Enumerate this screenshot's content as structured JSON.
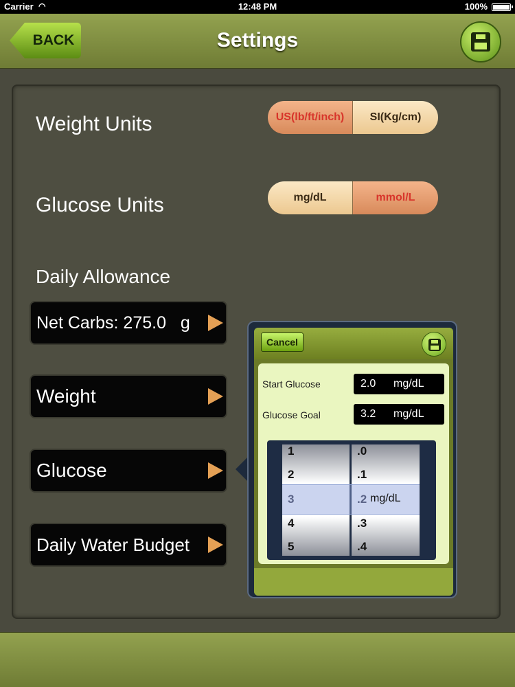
{
  "status_bar": {
    "carrier": "Carrier",
    "time": "12:48 PM",
    "battery": "100%"
  },
  "nav": {
    "back_label": "BACK",
    "title": "Settings",
    "save_icon": "floppy-disk-icon"
  },
  "settings": {
    "weight_units": {
      "label": "Weight Units",
      "options": [
        "US(lb/ft/inch)",
        "SI(Kg/cm)"
      ],
      "selected": "US(lb/ft/inch)"
    },
    "glucose_units": {
      "label": "Glucose Units",
      "options": [
        "mg/dL",
        "mmol/L"
      ],
      "selected": "mmol/L"
    },
    "daily_allowance_label": "Daily Allowance",
    "menu": [
      {
        "label": "Net Carbs: 275.0   g"
      },
      {
        "label": "Weight"
      },
      {
        "label": "Glucose"
      },
      {
        "label": "Daily Water Budget"
      }
    ]
  },
  "popover": {
    "cancel_label": "Cancel",
    "start_glucose": {
      "label": "Start Glucose",
      "value": "2.0",
      "unit": "mg/dL"
    },
    "glucose_goal": {
      "label": "Glucose Goal",
      "value": "3.2",
      "unit": "mg/dL"
    },
    "picker": {
      "integer_values": [
        "1",
        "2",
        "3",
        "4",
        "5"
      ],
      "decimal_values": [
        ".0",
        ".1",
        ".2",
        ".3",
        ".4"
      ],
      "selected_integer": "3",
      "selected_decimal": ".2",
      "unit": "mg/dL"
    }
  },
  "colors": {
    "accent_green": "#8ec63f",
    "selected_segment": "#d8352b",
    "panel": "#4e4e41"
  }
}
